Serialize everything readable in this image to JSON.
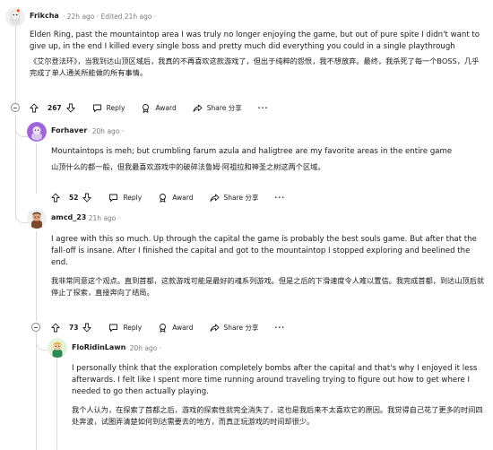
{
  "comments": [
    {
      "username": "Frikcha",
      "meta": "· 22h ago · Edited 21h ago ·",
      "en": "Elden Ring, past the mountaintop area I was truly no longer enjoying the game, but out of pure spite I didn't want to give up, in the end I killed every single boss and pretty much did everything you could in a single playthrough",
      "zh": "《艾尔登法环》，当我到达山顶区域后，我真的不再喜欢这款游戏了，但出于纯粹的怨恨，我不想放弃。最终，我杀死了每一个BOSS，几乎完成了单人通关所能做的所有事情。",
      "votes": "267",
      "reply": "Reply",
      "award": "Award",
      "share": "Share 分享",
      "more": "···"
    },
    {
      "username": "Forhaver",
      "meta": "· 20h ago ·",
      "en": "Mountaintops is meh; but crumbling farum azula and haligtree are my favorite areas in the entire game",
      "zh": "山顶什么的都一般，但我最喜欢游戏中的破碎法鲁姆·阿祖拉和神圣之树这两个区域。",
      "votes": "52",
      "reply": "Reply",
      "award": "Award",
      "share": "Share 分享",
      "more": "···"
    },
    {
      "username": "amcd_23",
      "meta": "· 21h ago ·",
      "en": "I agree with this so much. Up through the capital the game is probably the best souls game. But after that the fall-off is insane. After I finished the capital and got to the mountaintop I stopped exploring and beelined the end.",
      "zh": "我非常同意这个观点。直到首都，这款游戏可能是最好的魂系列游戏。但是之后的下滑速度令人难以置信。我完成首都，到达山顶后就停止了探索，直接奔向了结局。",
      "votes": "73",
      "reply": "Reply",
      "award": "Award",
      "share": "Share 分享",
      "more": "···"
    },
    {
      "username": "FloRidinLawn",
      "meta": "· 20h ago ·",
      "en": "I personally think that the exploration completely bombs after the capital and that's why I enjoyed it less afterwards. I felt like I spent more time running around traveling trying to figure out how to get where I needed to go then actually playing.",
      "zh": "我个人认为，在探索了首都之后，游戏的探索性就完全消失了，这也是我后来不太喜欢它的原因。我觉得自己花了更多的时间四处奔波，试图弄清楚如何到达需要去的地方，而真正玩游戏的时间却很少。"
    }
  ]
}
